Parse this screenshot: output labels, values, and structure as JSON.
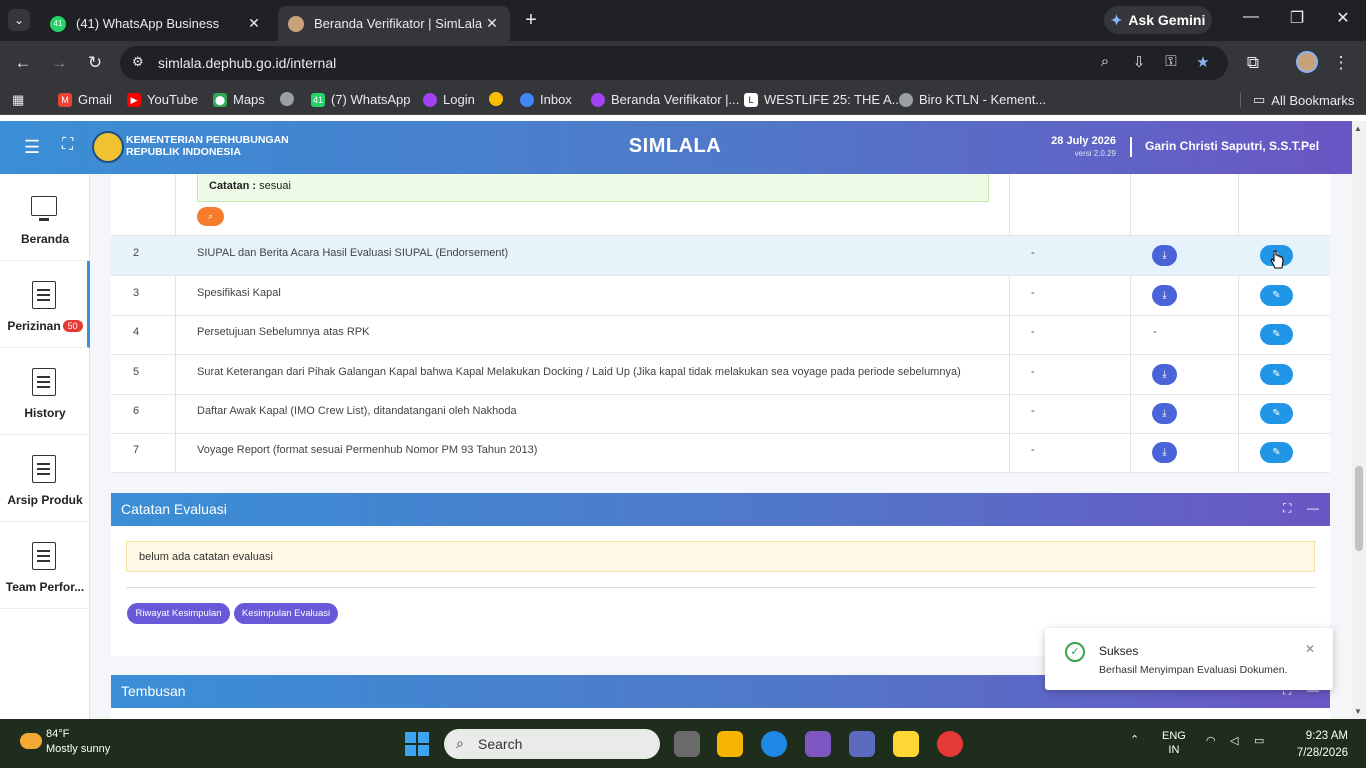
{
  "browser": {
    "tabs": [
      {
        "title": "(41) WhatsApp Business",
        "favicon_badge": "41",
        "active": false
      },
      {
        "title": "Beranda Verifikator | SimLala",
        "active": true
      }
    ],
    "gemini_label": "Ask Gemini",
    "url": "simlala.dephub.go.id/internal",
    "bookmarks": [
      {
        "label": "Gmail",
        "color": "#ea4335"
      },
      {
        "label": "YouTube",
        "color": "#ff0000"
      },
      {
        "label": "Maps",
        "color": "#34a853"
      },
      {
        "label": "",
        "color": "#9aa0a6"
      },
      {
        "label": "(7) WhatsApp",
        "color": "#25d366",
        "badge": "41"
      },
      {
        "label": "Login",
        "color": "#a142f4"
      },
      {
        "label": "",
        "color": "#fbbc04"
      },
      {
        "label": "Inbox",
        "color": "#4285f4"
      },
      {
        "label": "Beranda Verifikator |...",
        "color": "#a142f4"
      },
      {
        "label": "WESTLIFE 25: THE A...",
        "color": "#ffffff"
      },
      {
        "label": "Biro KTLN - Kement...",
        "color": "#9aa0a6"
      }
    ],
    "all_bookmarks": "All Bookmarks"
  },
  "header": {
    "org_line1": "KEMENTERIAN PERHUBUNGAN",
    "org_line2": "REPUBLIK INDONESIA",
    "app_title": "SIMLALA",
    "date": "28 July 2026",
    "version": "versi 2.0.29",
    "user": "Garin Christi Saputri, S.S.T.Pel"
  },
  "sidebar": {
    "items": [
      {
        "label": "Beranda"
      },
      {
        "label": "Perizinan",
        "badge": "50"
      },
      {
        "label": "History"
      },
      {
        "label": "Arsip Produk"
      },
      {
        "label": "Team Perfor..."
      }
    ]
  },
  "documents": {
    "prev_note_label": "Catatan :",
    "prev_note_value": "sesuai",
    "rows": [
      {
        "no": "2",
        "name": "SIUPAL dan Berita Acara Hasil Evaluasi SIUPAL (Endorsement)",
        "status": "-",
        "download": true
      },
      {
        "no": "3",
        "name": "Spesifikasi Kapal",
        "status": "-",
        "download": true
      },
      {
        "no": "4",
        "name": "Persetujuan Sebelumnya atas RPK",
        "status": "-",
        "download": false,
        "download_text": "-"
      },
      {
        "no": "5",
        "name": "Surat Keterangan dari Pihak Galangan Kapal bahwa Kapal Melakukan Docking / Laid Up (Jika kapal tidak melakukan sea voyage pada periode sebelumnya)",
        "status": "-",
        "download": true
      },
      {
        "no": "6",
        "name": "Daftar Awak Kapal (IMO Crew List), ditandatangani oleh Nakhoda",
        "status": "-",
        "download": true
      },
      {
        "no": "7",
        "name": "Voyage Report (format sesuai Permenhub Nomor PM 93 Tahun 2013)",
        "status": "-",
        "download": true
      }
    ]
  },
  "evaluasi": {
    "title": "Catatan Evaluasi",
    "empty_text": "belum ada catatan evaluasi",
    "btn_riwayat": "Riwayat Kesimpulan",
    "btn_kesimpulan": "Kesimpulan Evaluasi"
  },
  "tembusan": {
    "title": "Tembusan"
  },
  "toast": {
    "title": "Sukses",
    "message": "Berhasil Menyimpan Evaluasi Dokumen."
  },
  "taskbar": {
    "weather_temp": "84°F",
    "weather_desc": "Mostly sunny",
    "search_placeholder": "Search",
    "lang1": "ENG",
    "lang2": "IN",
    "time": "9:23 AM",
    "date": "7/28/2026"
  },
  "colors": {
    "header_gradient_start": "#3a8fd6",
    "header_gradient_end": "#6a56c4",
    "download_btn": "#4a63d8",
    "edit_btn": "#2196e6",
    "success": "#35a447"
  }
}
